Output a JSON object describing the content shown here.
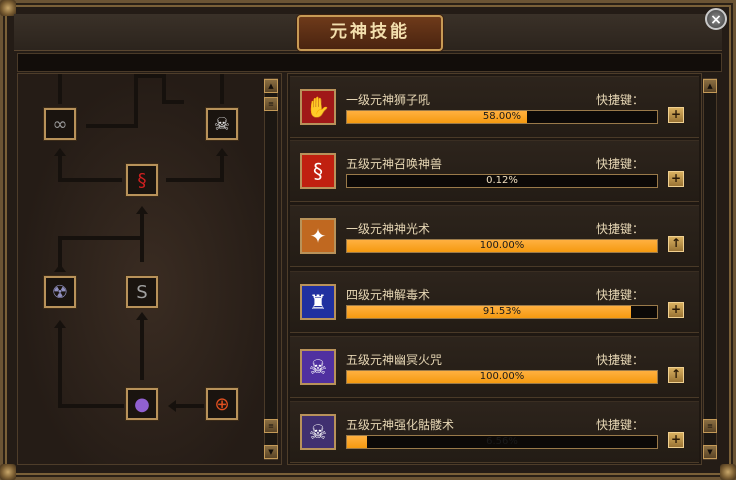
{
  "window": {
    "title": "元神技能",
    "close_label": "×"
  },
  "tree": {
    "nodes": [
      {
        "id": "n1",
        "icon": "chain-icon",
        "glyph": "∞",
        "color": "#9a9a9a"
      },
      {
        "id": "n2",
        "icon": "skull-icon",
        "glyph": "☠",
        "color": "#e8e8e8"
      },
      {
        "id": "n3",
        "icon": "dragon-icon",
        "glyph": "§",
        "color": "#d02020"
      },
      {
        "id": "n4",
        "icon": "poison-skull-icon",
        "glyph": "☢",
        "color": "#9090c0"
      },
      {
        "id": "n5",
        "icon": "serpent-icon",
        "glyph": "S",
        "color": "#a0a0a0"
      },
      {
        "id": "n6",
        "icon": "purple-orb-icon",
        "glyph": "●",
        "color": "#9060d0"
      },
      {
        "id": "n7",
        "icon": "target-icon",
        "glyph": "⊕",
        "color": "#e05020"
      }
    ]
  },
  "skills": [
    {
      "name": "一级元神狮子吼",
      "hotkey": "快捷键：",
      "progress_text": "58.00%",
      "progress": 0.58,
      "icon": "lion-roar-icon",
      "glyph": "✋",
      "bg": "#a01818",
      "button": "+",
      "button_icon": "plus-icon"
    },
    {
      "name": "五级元神召唤神兽",
      "hotkey": "快捷键：",
      "progress_text": "0.12%",
      "progress": 0.0012,
      "icon": "summon-beast-icon",
      "glyph": "§",
      "bg": "#c02010",
      "button": "+",
      "button_icon": "plus-icon"
    },
    {
      "name": "一级元神神光术",
      "hotkey": "快捷键：",
      "progress_text": "100.00%",
      "progress": 1.0,
      "icon": "holy-light-icon",
      "glyph": "✦",
      "bg": "#c06820",
      "button": "↑",
      "button_icon": "upgrade-arrow-icon"
    },
    {
      "name": "四级元神解毒术",
      "hotkey": "快捷键：",
      "progress_text": "91.53%",
      "progress": 0.9153,
      "icon": "detox-icon",
      "glyph": "♜",
      "bg": "#2030a0",
      "button": "+",
      "button_icon": "plus-icon"
    },
    {
      "name": "五级元神幽冥火咒",
      "hotkey": "快捷键：",
      "progress_text": "100.00%",
      "progress": 1.0,
      "icon": "nether-fire-icon",
      "glyph": "☠",
      "bg": "#5030a0",
      "button": "↑",
      "button_icon": "upgrade-arrow-icon"
    },
    {
      "name": "五级元神强化骷髅术",
      "hotkey": "快捷键：",
      "progress_text": "6.56%",
      "progress": 0.0656,
      "icon": "skeleton-icon",
      "glyph": "☠",
      "bg": "#403070",
      "button": "+",
      "button_icon": "plus-icon"
    }
  ],
  "scrollbars": {
    "up_glyph": "▲",
    "down_glyph": "▼",
    "grip_glyph": "≡"
  }
}
